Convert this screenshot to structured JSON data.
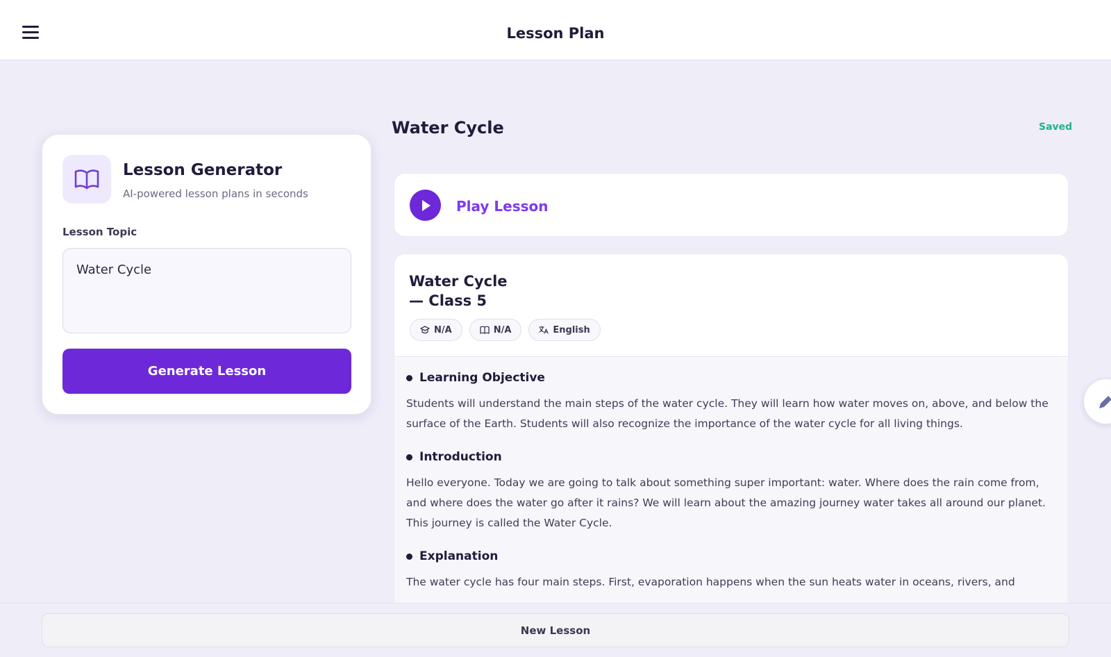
{
  "header": {
    "title": "Lesson Plan",
    "menu_icon": "hamburger-menu-icon"
  },
  "generator": {
    "icon": "open-book-icon",
    "title": "Lesson Generator",
    "subtitle": "AI-powered lesson plans in seconds",
    "topic_label": "Lesson Topic",
    "topic_value": "Water Cycle",
    "generate_label": "Generate Lesson"
  },
  "lesson": {
    "heading": "Water Cycle",
    "status": "Saved",
    "play_label": "Play Lesson",
    "title": "Water Cycle\n — Class 5",
    "chips": [
      {
        "icon": "graduation-cap-icon",
        "label": "N/A"
      },
      {
        "icon": "book-icon",
        "label": "N/A"
      },
      {
        "icon": "translate-icon",
        "label": "English"
      }
    ],
    "sections": [
      {
        "title": "Learning Objective",
        "text": "Students will understand the main steps of the water cycle. They will learn how water moves on, above, and below the surface of the Earth. Students will also recognize the importance of the water cycle for all living things."
      },
      {
        "title": "Introduction",
        "text": "Hello everyone. Today we are going to talk about something super important: water. Where does the rain come from, and where does the water go after it rains? We will learn about the amazing journey water takes all around our planet. This journey is called the Water Cycle."
      },
      {
        "title": "Explanation",
        "text": "The water cycle has four main steps. First, evaporation happens when the sun heats water in oceans, rivers, and"
      }
    ]
  },
  "footer": {
    "new_lesson_label": "New Lesson"
  },
  "colors": {
    "accent": "#6d28d9",
    "accent_text": "#7c3aed",
    "saved": "#1fb486",
    "background": "#efedf8"
  }
}
